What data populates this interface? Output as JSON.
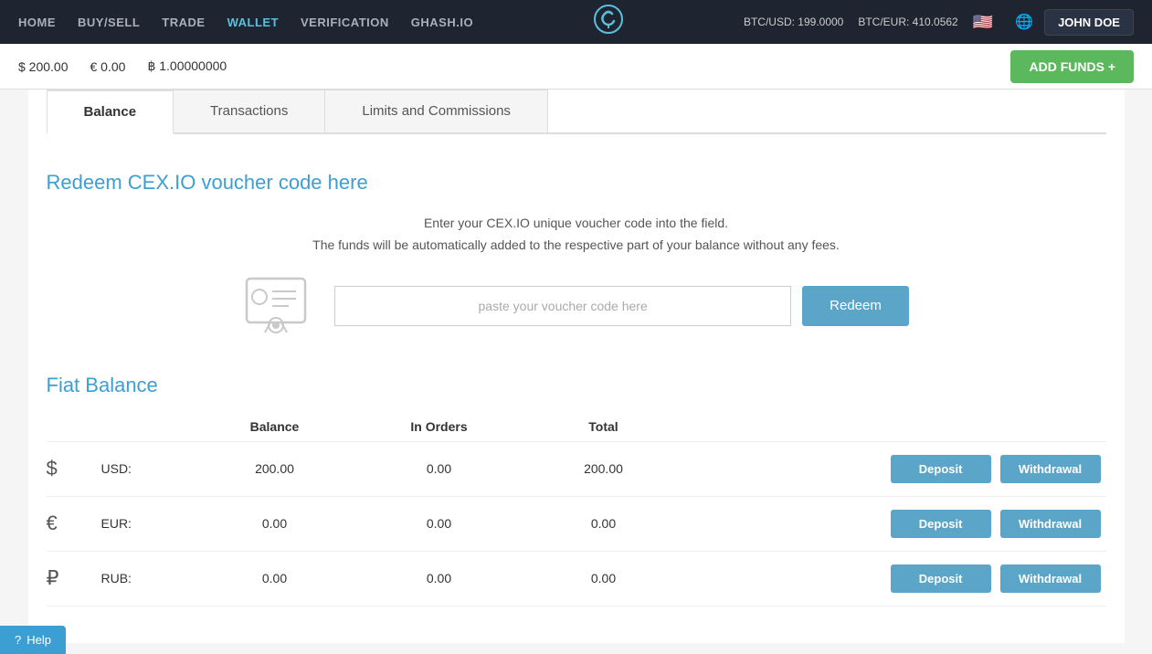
{
  "navbar": {
    "links": [
      {
        "label": "HOME",
        "active": false
      },
      {
        "label": "BUY/SELL",
        "active": false
      },
      {
        "label": "TRADE",
        "active": false
      },
      {
        "label": "WALLET",
        "active": true
      },
      {
        "label": "VERIFICATION",
        "active": false
      },
      {
        "label": "GHASH.IO",
        "active": false
      }
    ],
    "logo": "C",
    "btcusd": "BTC/USD: 199.0000",
    "btceur": "BTC/EUR: 410.0562",
    "user": "JOHN DOE"
  },
  "balance_bar": {
    "usd": "$ 200.00",
    "eur": "€ 0.00",
    "btc": "฿ 1.00000000",
    "add_funds_label": "ADD FUNDS +"
  },
  "tabs": [
    {
      "label": "Balance",
      "active": true
    },
    {
      "label": "Transactions",
      "active": false
    },
    {
      "label": "Limits and Commissions",
      "active": false
    }
  ],
  "voucher": {
    "title": "Redeem CEX.IO voucher code here",
    "desc_line1": "Enter your CEX.IO unique voucher code into the field.",
    "desc_line2": "The funds will be automatically added to the respective part of your balance without any fees.",
    "placeholder": "paste your voucher code here",
    "redeem_label": "Redeem"
  },
  "fiat": {
    "title": "Fiat Balance",
    "columns": [
      "",
      "",
      "Balance",
      "In Orders",
      "Total",
      ""
    ],
    "rows": [
      {
        "icon": "$",
        "currency": "USD:",
        "balance": "200.00",
        "in_orders": "0.00",
        "total": "200.00"
      },
      {
        "icon": "€",
        "currency": "EUR:",
        "balance": "0.00",
        "in_orders": "0.00",
        "total": "0.00"
      },
      {
        "icon": "₽",
        "currency": "RUB:",
        "balance": "0.00",
        "in_orders": "0.00",
        "total": "0.00"
      }
    ],
    "deposit_label": "Deposit",
    "withdrawal_label": "Withdrawal"
  },
  "help": {
    "label": "Help"
  }
}
